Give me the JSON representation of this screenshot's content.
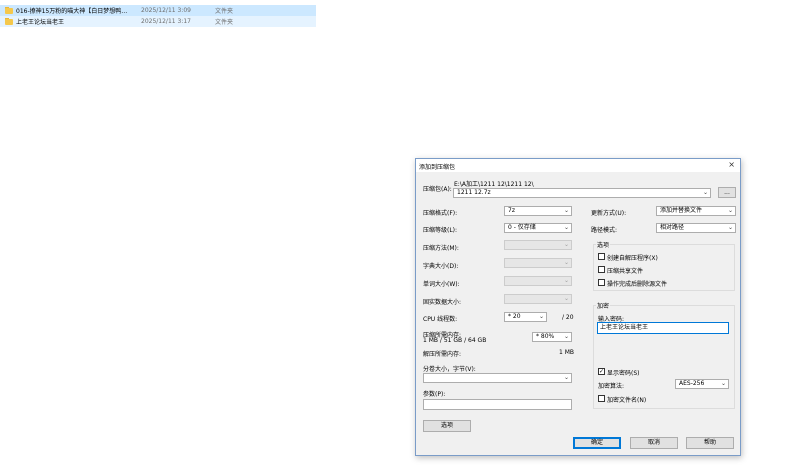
{
  "files": [
    {
      "name": "016-撩神15万粉的喵大神【白日梦想鸭…",
      "date": "2025/12/11 3:09",
      "type": "文件夹"
    },
    {
      "name": "上老王论坛当老王",
      "date": "2025/12/11 3:17",
      "type": "文件夹"
    }
  ],
  "dialog": {
    "title": "添加到压缩包",
    "close_glyph": "×",
    "archive_label": "压缩包(A):",
    "archive_path": "E:\\A加工\\1211 12\\1211 12\\",
    "archive_name": "1211 12.7z",
    "browse_label": "...",
    "format_label": "压缩格式(F):",
    "format_value": "7z",
    "level_label": "压缩等级(L):",
    "level_value": "0 - 仅存储",
    "method_label": "压缩方法(M):",
    "dict_label": "字典大小(D):",
    "word_label": "单词大小(W):",
    "solid_label": "固实数据大小:",
    "threads_label": "CPU 线程数:",
    "threads_value": "* 20",
    "threads_total": "/ 20",
    "mem_comp_label": "压缩所需内存:",
    "mem_comp_detail": "1 MB / 51 GB / 64 GB",
    "mem_percent": "* 80%",
    "mem_decomp_label": "解压所需内存:",
    "mem_decomp_value": "1 MB",
    "split_label": "分卷大小，字节(V):",
    "params_label": "参数(P):",
    "options_button": "选项",
    "update_label": "更新方式(U):",
    "update_value": "添加并替换文件",
    "path_label": "路径模式:",
    "path_value": "相对路径",
    "options_group": {
      "title": "选项",
      "sfx": "创建自解压程序(X)",
      "shared": "压缩共享文件",
      "delete": "操作完成后删除源文件"
    },
    "encrypt_group": {
      "title": "加密",
      "password_label": "输入密码:",
      "password_value": "上老王论坛当老王",
      "show_password": "显示密码(S)",
      "method_label": "加密算法:",
      "method_value": "AES-256",
      "encrypt_names": "加密文件名(N)"
    },
    "ok": "确定",
    "cancel": "取消",
    "help": "帮助",
    "check_mark": "✓",
    "dropdown_arrow": "⌄"
  }
}
